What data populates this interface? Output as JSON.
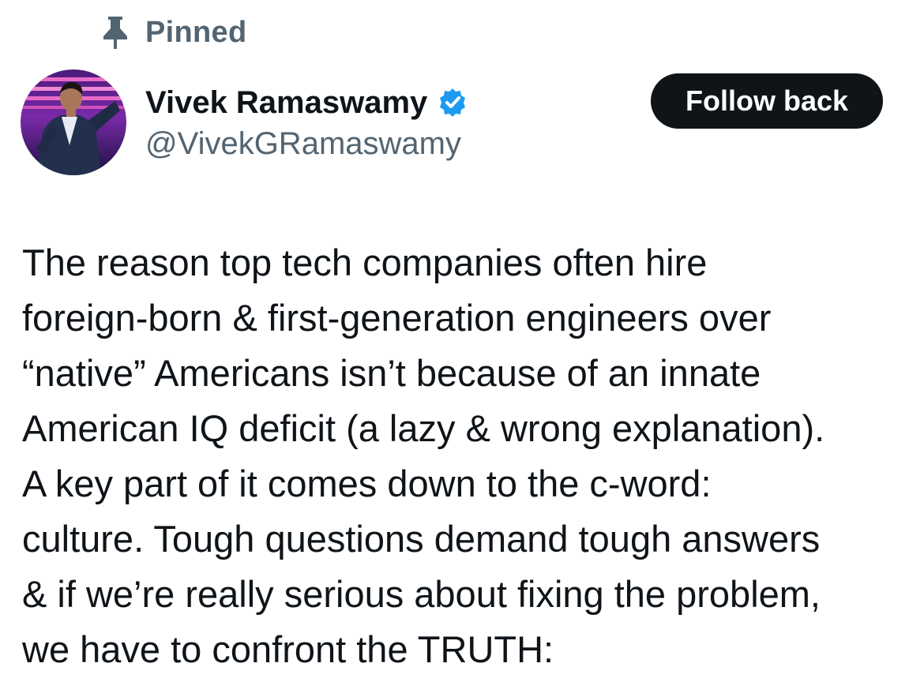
{
  "pinned": {
    "icon": "pin-icon",
    "label": "Pinned"
  },
  "author": {
    "display_name": "Vivek Ramaswamy",
    "handle": "@VivekGRamaswamy",
    "verified_icon": "verified-badge-icon",
    "verified_color": "#1d9bf0"
  },
  "follow_button": {
    "label": "Follow back"
  },
  "tweet": {
    "lines": [
      "The reason top tech companies often hire",
      "foreign-born & first-generation engineers over",
      "“native” Americans isn’t because of an innate",
      "American IQ deficit (a lazy & wrong explanation).",
      "A key part of it comes down to the c-word:",
      "culture. Tough questions demand tough answers",
      "& if we’re really serious about fixing the problem,",
      "we have to confront the TRUTH:"
    ]
  },
  "colors": {
    "text_primary": "#0f1419",
    "text_secondary": "#536471",
    "button_bg": "#0f1419",
    "background": "#ffffff"
  }
}
